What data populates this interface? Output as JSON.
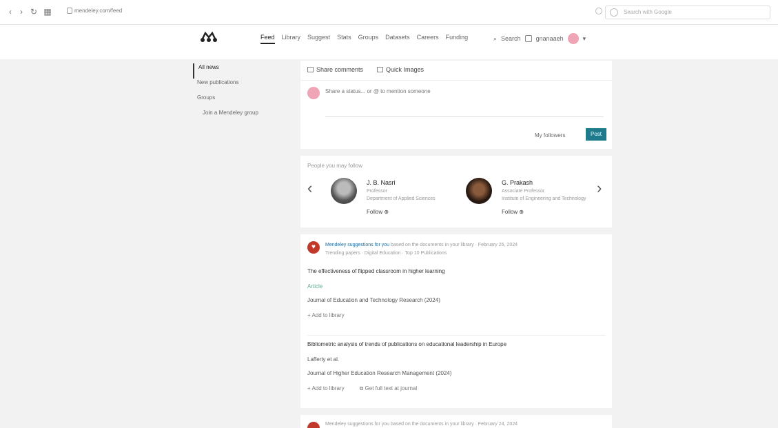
{
  "browser": {
    "url": "mendeley.com/feed",
    "search_placeholder": "Search with Google"
  },
  "header": {
    "nav": [
      "Feed",
      "Library",
      "Suggest",
      "Stats",
      "Groups",
      "Datasets",
      "Careers",
      "Funding"
    ],
    "active_nav": "Feed",
    "search_label": "Search",
    "user_name": "gnanaaeh",
    "menu_label": "▾"
  },
  "sidebar": {
    "items": [
      "All news",
      "New publications",
      "Groups",
      "Join a Mendeley group"
    ]
  },
  "composer": {
    "tabs": [
      "Share comments",
      "Quick Images"
    ],
    "placeholder": "Share a status... or @ to mention someone",
    "visibility": "My followers",
    "post_label": "Post"
  },
  "suggestions": {
    "heading": "People you may follow",
    "people": [
      {
        "name": "J. B. Nasri",
        "role": "Professor",
        "institution": "Department of Applied Sciences",
        "follow_label": "Follow"
      },
      {
        "name": "G. Prakash",
        "role": "Associate Professor",
        "institution": "Institute of Engineering and Technology",
        "follow_label": "Follow"
      }
    ]
  },
  "feed": {
    "header_name": "Mendeley suggestions for you",
    "header_text": "based on the documents in your library  ·  February 25, 2024",
    "header_subline": "Trending papers  ·  Digital Education  ·  Top 10 Publications",
    "entries": [
      {
        "title": "The effectiveness of flipped classroom in higher learning",
        "meta": "Article",
        "source": "Journal of Education and Technology Research (2024)",
        "actions": [
          "Add to library"
        ]
      },
      {
        "title": "Bibliometric analysis of trends of publications on educational leadership in Europe",
        "meta": "Lafferty et al.",
        "source": "Journal of Higher Education Research Management (2024)",
        "actions": [
          "Add to library",
          "Get full text at journal"
        ]
      }
    ],
    "next_header": "Mendeley suggestions for you  based on the documents in your library  ·  February 24, 2024"
  }
}
